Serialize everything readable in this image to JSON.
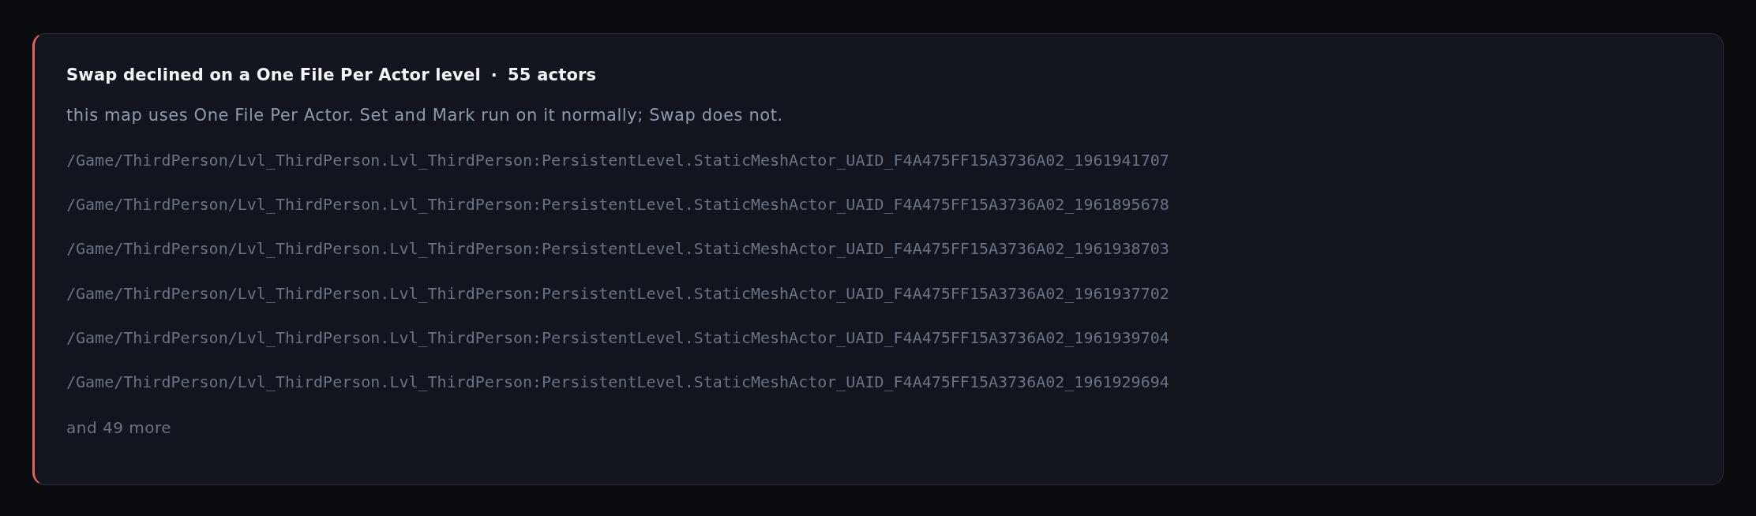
{
  "notice": {
    "title": "Swap declined on a One File Per Actor level",
    "separator": "·",
    "count": "55 actors",
    "message": "this map uses One File Per Actor. Set and Mark run on it normally; Swap does not.",
    "actor_paths": [
      "/Game/ThirdPerson/Lvl_ThirdPerson.Lvl_ThirdPerson:PersistentLevel.StaticMeshActor_UAID_F4A475FF15A3736A02_1961941707",
      "/Game/ThirdPerson/Lvl_ThirdPerson.Lvl_ThirdPerson:PersistentLevel.StaticMeshActor_UAID_F4A475FF15A3736A02_1961895678",
      "/Game/ThirdPerson/Lvl_ThirdPerson.Lvl_ThirdPerson:PersistentLevel.StaticMeshActor_UAID_F4A475FF15A3736A02_1961938703",
      "/Game/ThirdPerson/Lvl_ThirdPerson.Lvl_ThirdPerson:PersistentLevel.StaticMeshActor_UAID_F4A475FF15A3736A02_1961937702",
      "/Game/ThirdPerson/Lvl_ThirdPerson.Lvl_ThirdPerson:PersistentLevel.StaticMeshActor_UAID_F4A475FF15A3736A02_1961939704",
      "/Game/ThirdPerson/Lvl_ThirdPerson.Lvl_ThirdPerson:PersistentLevel.StaticMeshActor_UAID_F4A475FF15A3736A02_1961929694"
    ],
    "more": "and 49 more"
  }
}
